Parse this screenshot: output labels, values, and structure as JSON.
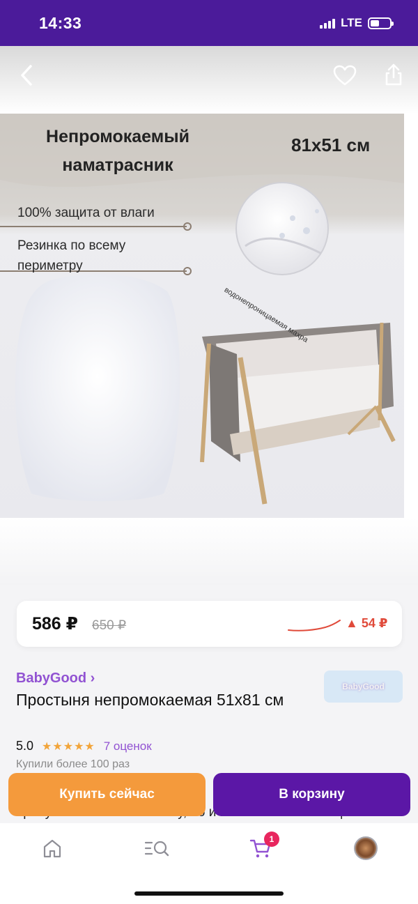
{
  "status_bar": {
    "time": "14:33",
    "network": "LTE"
  },
  "image": {
    "title": "Непромокаемый наматрасник",
    "size": "81х51 см",
    "feature1": "100% защита от влаги",
    "feature2": "Резинка по всему периметру",
    "caption": "водонепроницаемая махра"
  },
  "price": {
    "current": "586 ₽",
    "old": "650 ₽",
    "change": "▲ 54 ₽",
    "trend_color": "#e04a3a"
  },
  "product": {
    "brand": "BabyGood ›",
    "brand_logo": "BabyGood",
    "title": "Простыня непромокаемая 51х81 см",
    "rating": "5.0",
    "stars": "★★★★★",
    "reviews": "7 оценок",
    "bought": "Купили более 100 раз",
    "description_fragment_1": "м",
    "description_fragment_2": "пропускает не только влагу, но и мельчайшие частицы"
  },
  "actions": {
    "buy_now": "Купить сейчас",
    "add_to_cart": "В корзину"
  },
  "nav": {
    "items": [
      "home-icon",
      "catalog-search-icon",
      "cart-icon",
      "profile-avatar"
    ],
    "cart_count": "1",
    "active_color": "#9152d2"
  },
  "colors": {
    "brand_purple": "#4b1b9a",
    "buy_orange": "#f49a3c",
    "cart_purple": "#5b17a6"
  }
}
